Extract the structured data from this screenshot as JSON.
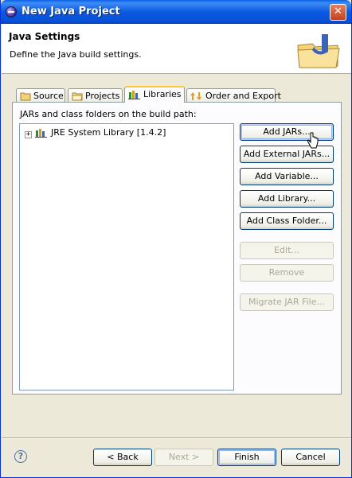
{
  "window": {
    "title": "New Java Project"
  },
  "header": {
    "title": "Java Settings",
    "description": "Define the Java build settings."
  },
  "tabs": [
    {
      "label": "Source",
      "icon": "source-folder-icon"
    },
    {
      "label": "Projects",
      "icon": "projects-folder-icon"
    },
    {
      "label": "Libraries",
      "icon": "libraries-icon",
      "active": true
    },
    {
      "label": "Order and Export",
      "icon": "order-export-icon"
    }
  ],
  "panel": {
    "label": "JARs and class folders on the build path:",
    "tree": [
      {
        "label": "JRE System Library [1.4.2]",
        "expander": "+"
      }
    ]
  },
  "buttons": {
    "add_jars": "Add JARs...",
    "add_external_jars": "Add External JARs...",
    "add_variable": "Add Variable...",
    "add_library": "Add Library...",
    "add_class_folder": "Add Class Folder...",
    "edit": "Edit...",
    "remove": "Remove",
    "migrate_jar": "Migrate JAR File..."
  },
  "footer": {
    "back": "< Back",
    "next": "Next >",
    "finish": "Finish",
    "cancel": "Cancel",
    "help": "?"
  },
  "colors": {
    "titlebar": "#0a5fe6",
    "dialog_bg": "#ece9d8",
    "tab_highlight": "#ffc83c"
  }
}
